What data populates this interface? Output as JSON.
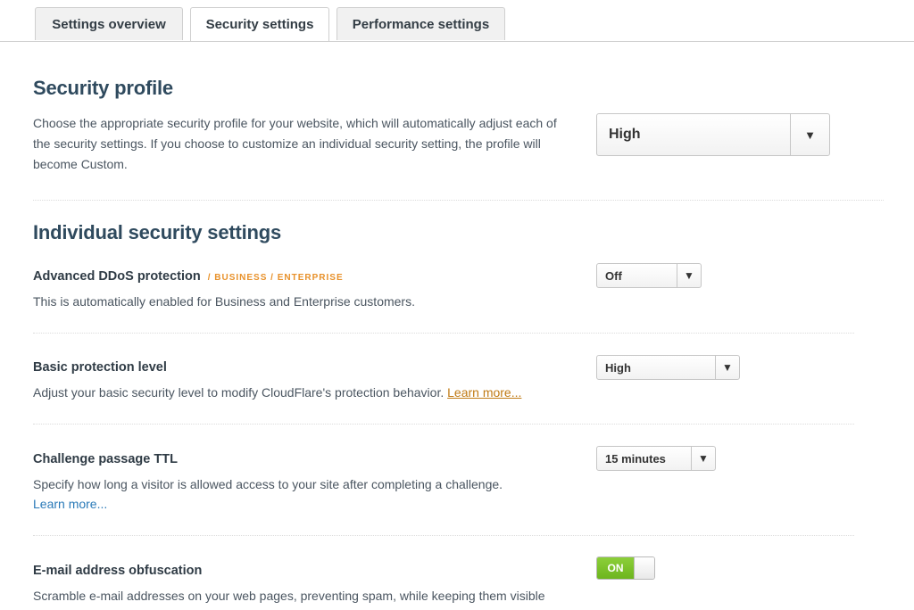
{
  "tabs": [
    {
      "label": "Settings overview"
    },
    {
      "label": "Security settings"
    },
    {
      "label": "Performance settings"
    }
  ],
  "security_profile": {
    "title": "Security profile",
    "description": "Choose the appropriate security profile for your website, which will automatically adjust each of the security settings. If you choose to customize an individual security setting, the profile will become Custom.",
    "selected": "High",
    "arrow": "▼"
  },
  "individual": {
    "title": "Individual security settings",
    "ddos": {
      "label": "Advanced DDoS protection",
      "tag": "/ BUSINESS / ENTERPRISE",
      "description": "This is automatically enabled for Business and Enterprise customers.",
      "selected": "Off",
      "arrow": "▼"
    },
    "basic": {
      "label": "Basic protection level",
      "description": "Adjust your basic security level to modify CloudFlare's protection behavior. ",
      "link": "Learn more...",
      "selected": "High",
      "arrow": "▼"
    },
    "ttl": {
      "label": "Challenge passage TTL",
      "description": "Specify how long a visitor is allowed access to your site after completing a challenge.",
      "link": "Learn more...",
      "selected": "15 minutes",
      "arrow": "▼"
    },
    "email": {
      "label": "E-mail address obfuscation",
      "description": "Scramble e-mail addresses on your web pages, preventing spam, while keeping them visible",
      "toggle_label": "ON"
    }
  },
  "colors": {
    "heading": "#2f4a5e",
    "plan_tag": "#e8912a",
    "toggle_on": "#7cc12a",
    "link_blue": "#2a7ab8"
  }
}
